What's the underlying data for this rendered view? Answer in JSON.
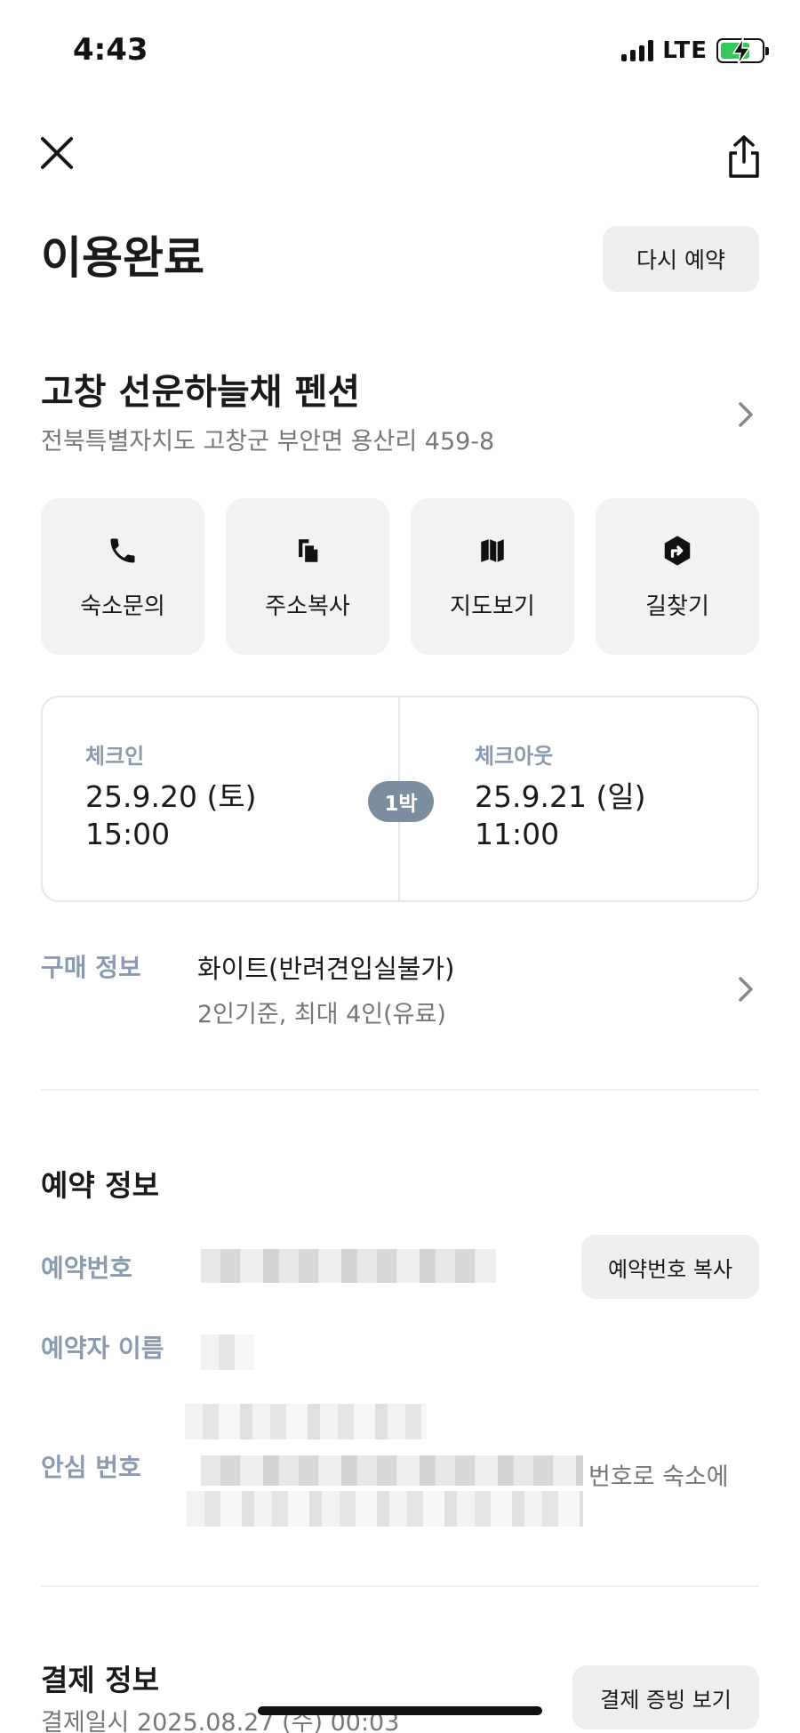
{
  "status_bar": {
    "time": "4:43",
    "network": "LTE"
  },
  "header": {
    "title": "이용완료",
    "rebook_label": "다시 예약"
  },
  "property": {
    "name": "고창 선운하늘채 펜션",
    "address": "전북특별자치도 고창군 부안면 용산리 459-8"
  },
  "actions": [
    {
      "label": "숙소문의",
      "icon": "phone-icon"
    },
    {
      "label": "주소복사",
      "icon": "copy-icon"
    },
    {
      "label": "지도보기",
      "icon": "map-icon"
    },
    {
      "label": "길찾기",
      "icon": "directions-icon"
    }
  ],
  "stay": {
    "checkin_label": "체크인",
    "checkin_date": "25.9.20 (토)",
    "checkin_time": "15:00",
    "checkout_label": "체크아웃",
    "checkout_date": "25.9.21 (일)",
    "checkout_time": "11:00",
    "nights": "1박"
  },
  "purchase": {
    "label": "구매 정보",
    "room": "화이트(반려견입실불가)",
    "occupancy": "2인기준, 최대 4인(유료)"
  },
  "reservation": {
    "title": "예약 정보",
    "number_label": "예약번호",
    "copy_label": "예약번호 복사",
    "name_label": "예약자 이름",
    "safe_number_label": "안심 번호",
    "safe_number_text": "번호로 숙소에"
  },
  "payment": {
    "title": "결제 정보",
    "date": "결제일시 2025.08.27 (수) 00:03",
    "receipt_label": "결제 증빙 보기"
  }
}
